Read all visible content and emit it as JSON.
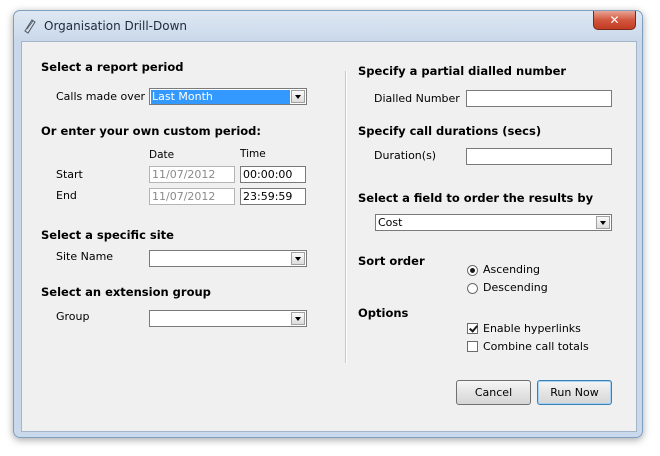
{
  "window": {
    "title": "Organisation Drill-Down",
    "close_label": "✕"
  },
  "left": {
    "report_period": {
      "heading": "Select a report period",
      "label": "Calls made over",
      "value": "Last Month"
    },
    "custom_period": {
      "heading": "Or enter your own custom period:",
      "date_header": "Date",
      "time_header": "Time",
      "start_label": "Start",
      "end_label": "End",
      "start_date": "11/07/2012",
      "start_time": "00:00:00",
      "end_date": "11/07/2012",
      "end_time": "23:59:59"
    },
    "site": {
      "heading": "Select a specific site",
      "label": "Site Name",
      "value": ""
    },
    "extension_group": {
      "heading": "Select an extension group",
      "label": "Group",
      "value": ""
    }
  },
  "right": {
    "dialled": {
      "heading": "Specify a partial dialled number",
      "label": "Dialled Number",
      "value": ""
    },
    "durations": {
      "heading": "Specify call durations (secs)",
      "label": "Duration(s)",
      "value": ""
    },
    "order_field": {
      "heading": "Select a field to order the results by",
      "value": "Cost"
    },
    "sort_order": {
      "heading": "Sort order",
      "ascending": "Ascending",
      "descending": "Descending",
      "selected": "ascending"
    },
    "options": {
      "heading": "Options",
      "hyperlinks": "Enable hyperlinks",
      "combine": "Combine call totals"
    }
  },
  "buttons": {
    "cancel": "Cancel",
    "run": "Run Now"
  }
}
